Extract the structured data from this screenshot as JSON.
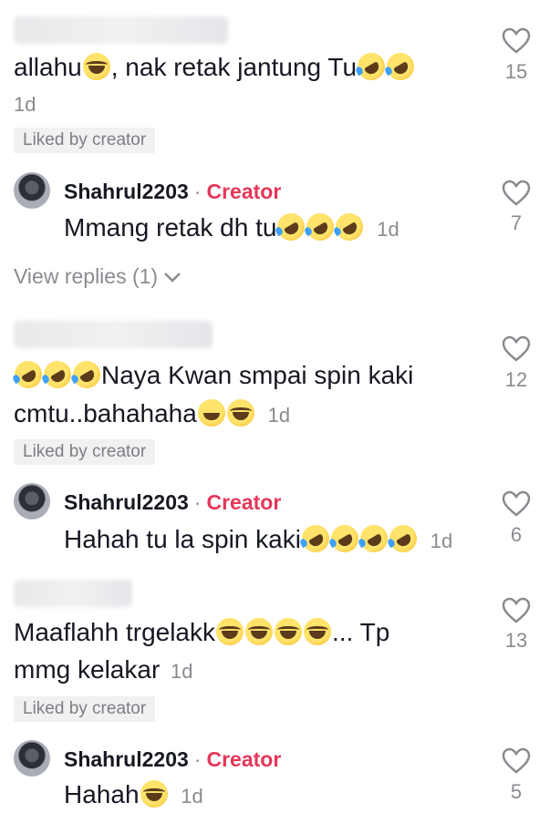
{
  "comments": [
    {
      "text": "allahu",
      "text2": ", nak retak jantung Tu",
      "time": "1d",
      "likes": "15",
      "liked_label": "Liked by creator"
    },
    {
      "user": "Shahrul2203",
      "dot": "·",
      "tag": "Creator",
      "text": "Mmang retak dh tu",
      "time": "1d",
      "likes": "7",
      "view_replies": "View replies (1)"
    },
    {
      "text": "Naya Kwan smpai spin kaki",
      "line2": "cmtu..bahahaha",
      "time": "1d",
      "likes": "12",
      "liked_label": "Liked by creator"
    },
    {
      "user": "Shahrul2203",
      "dot": "·",
      "tag": "Creator",
      "text": "Hahah tu la spin kaki",
      "time": "1d",
      "likes": "6"
    },
    {
      "text": "Maaflahh trgelakk",
      "text_after": "... Tp",
      "line2": "mmg kelakar",
      "time": "1d",
      "likes": "13",
      "liked_label": "Liked by creator"
    },
    {
      "user": "Shahrul2203",
      "dot": "·",
      "tag": "Creator",
      "text": "Hahah",
      "time": "1d",
      "likes": "5"
    }
  ],
  "icons": {
    "like": "heart-outline-icon",
    "expand": "chevron-down-icon",
    "emoji_laugh": "tears-of-joy",
    "emoji_rofl": "rolling-on-floor-laughing",
    "emoji_smile": "grinning-sweat"
  },
  "colors": {
    "creator_tag": "#e6375a",
    "muted": "#8a8b91"
  }
}
